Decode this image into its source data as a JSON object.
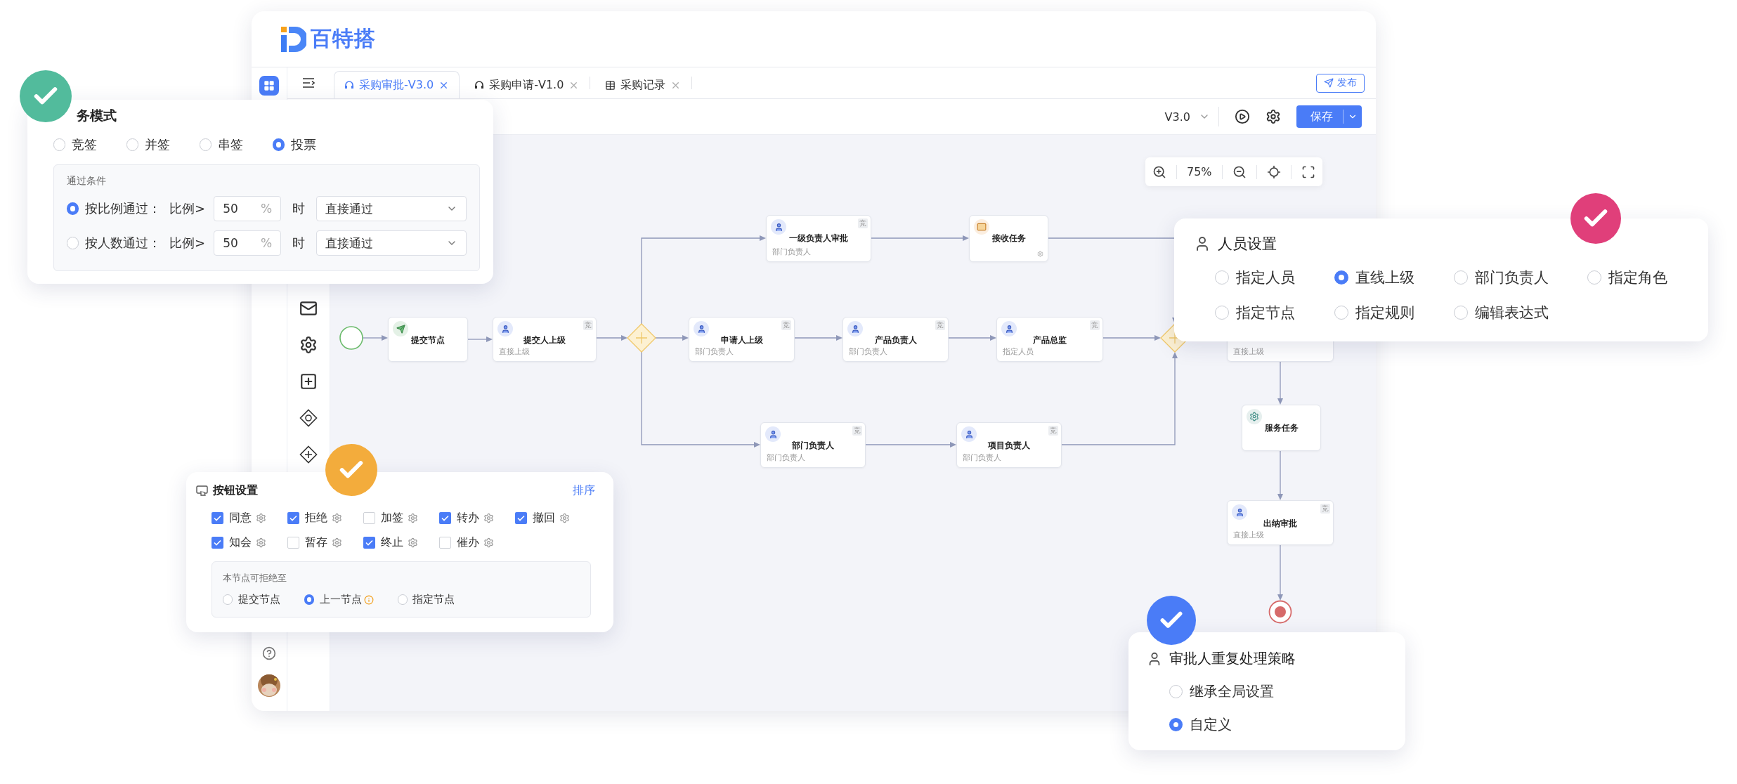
{
  "logo": {
    "text": "百特搭"
  },
  "tabs": [
    {
      "label": "采购审批-V3.0",
      "selected": true,
      "kind": "flow"
    },
    {
      "label": "采购申请-V1.0",
      "selected": false,
      "kind": "flow"
    },
    {
      "label": "采购记录",
      "selected": false,
      "kind": "table"
    }
  ],
  "publish_button": "发布",
  "toolbar": {
    "version": "V3.0",
    "save_button": "保存"
  },
  "zoom": {
    "value": "75%"
  },
  "flow": {
    "nodes": [
      {
        "kind": "start"
      },
      {
        "kind": "send",
        "title": "提交节点"
      },
      {
        "kind": "user",
        "title": "提交人上级",
        "subtitle": "直接上级",
        "badge": "竞"
      },
      {
        "kind": "gateway"
      },
      {
        "kind": "user",
        "title": "一级负责人审批",
        "subtitle": "部门负责人",
        "badge": "竞"
      },
      {
        "kind": "receive",
        "title": "接收任务"
      },
      {
        "kind": "user",
        "title": "申请人上级",
        "subtitle": "部门负责人",
        "badge": "竞"
      },
      {
        "kind": "user",
        "title": "产品负责人",
        "subtitle": "部门负责人",
        "badge": "竞"
      },
      {
        "kind": "user",
        "title": "产品总监",
        "subtitle": "指定人员",
        "badge": "竞"
      },
      {
        "kind": "gateway"
      },
      {
        "kind": "user",
        "title": "部门负责人",
        "subtitle": "部门负责人",
        "badge": "竞"
      },
      {
        "kind": "user",
        "title": "项目负责人",
        "subtitle": "部门负责人",
        "badge": "竞"
      },
      {
        "kind": "task",
        "subtitle": "直接上级"
      },
      {
        "kind": "service",
        "title": "服务任务"
      },
      {
        "kind": "user",
        "title": "出纳审批",
        "subtitle": "直接上级",
        "badge": "竞"
      },
      {
        "kind": "end"
      }
    ]
  },
  "sign_mode": {
    "title": "务模式",
    "options": [
      {
        "label": "竞签",
        "selected": false
      },
      {
        "label": "并签",
        "selected": false
      },
      {
        "label": "串签",
        "selected": false
      },
      {
        "label": "投票",
        "selected": true
      }
    ],
    "condition": {
      "title": "通过条件",
      "rules": [
        {
          "label": "按比例通过：",
          "ratio_label": "比例>",
          "value": "50",
          "unit": "%",
          "when": "时",
          "action": "直接通过",
          "selected": true
        },
        {
          "label": "按人数通过：",
          "ratio_label": "比例>",
          "value": "50",
          "unit": "%",
          "when": "时",
          "action": "直接通过",
          "selected": false
        }
      ]
    }
  },
  "button_settings": {
    "title": "按钮设置",
    "sort_link": "排序",
    "buttons": [
      {
        "label": "同意",
        "checked": true
      },
      {
        "label": "拒绝",
        "checked": true
      },
      {
        "label": "加签",
        "checked": false
      },
      {
        "label": "转办",
        "checked": true
      },
      {
        "label": "撤回",
        "checked": true
      },
      {
        "label": "知会",
        "checked": true
      },
      {
        "label": "暂存",
        "checked": false
      },
      {
        "label": "终止",
        "checked": true
      },
      {
        "label": "催办",
        "checked": false
      }
    ],
    "reject_to": {
      "title": "本节点可拒绝至",
      "options": [
        {
          "label": "提交节点",
          "selected": false,
          "info": false
        },
        {
          "label": "上一节点",
          "selected": true,
          "info": true
        },
        {
          "label": "指定节点",
          "selected": false,
          "info": false
        }
      ]
    }
  },
  "people": {
    "title": "人员设置",
    "options": [
      {
        "label": "指定人员",
        "selected": false
      },
      {
        "label": "直线上级",
        "selected": true
      },
      {
        "label": "部门负责人",
        "selected": false
      },
      {
        "label": "指定角色",
        "selected": false
      },
      {
        "label": "指定节点",
        "selected": false
      },
      {
        "label": "指定规则",
        "selected": false
      },
      {
        "label": "编辑表达式",
        "selected": false
      }
    ]
  },
  "duplicate": {
    "title": "审批人重复处理策略",
    "options": [
      {
        "label": "继承全局设置",
        "selected": false
      },
      {
        "label": "自定义",
        "selected": true
      }
    ]
  }
}
